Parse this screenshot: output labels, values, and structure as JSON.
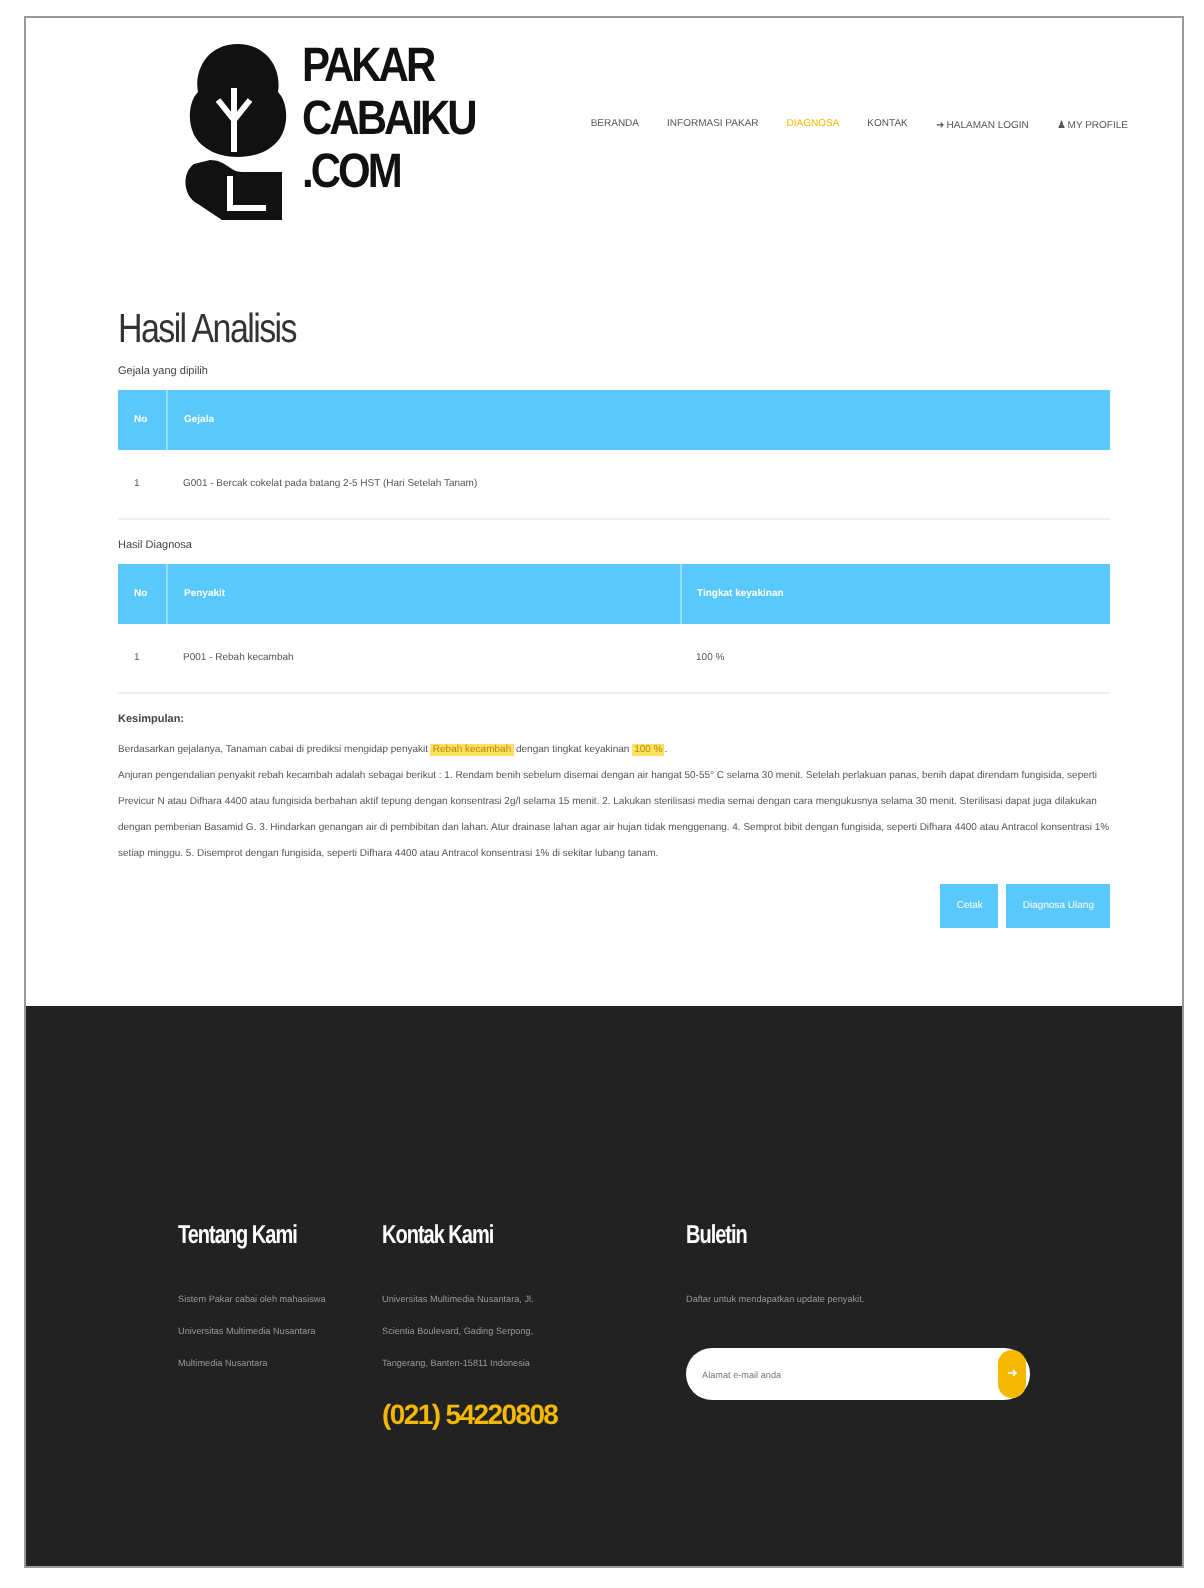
{
  "header": {
    "logo_text": [
      "PAKAR",
      "CABAIKU",
      ".COM"
    ],
    "nav": [
      {
        "label": "BERANDA",
        "selected": false
      },
      {
        "label": "INFORMASI PAKAR",
        "selected": false
      },
      {
        "label": "DIAGNOSA",
        "selected": true
      },
      {
        "label": "KONTAK",
        "selected": false
      },
      {
        "label": "➜ HALAMAN LOGIN",
        "selected": false
      },
      {
        "label": "♟ MY PROFILE",
        "selected": false
      }
    ]
  },
  "title": "Hasil Analisis",
  "tables": [
    {
      "caption": "Gejala yang dipilih",
      "columns": [
        "No",
        "Gejala"
      ],
      "rows": [
        [
          "1",
          "G001 - Bercak cokelat pada batang 2-5 HST (Hari Setelah Tanam)"
        ]
      ]
    },
    {
      "caption": "Hasil Diagnosa",
      "columns": [
        "No",
        "Penyakit",
        "Tingkat keyakinan"
      ],
      "rows": [
        [
          "1",
          "P001 - Rebah kecambah",
          "100 %"
        ]
      ]
    }
  ],
  "conclusion": {
    "heading": "Kesimpulan:",
    "paragraphs": [
      "Berdasarkan gejalanya, Tanaman cabai di prediksi mengidap penyakit **Rebah kecambah** dengan tingkat keyakinan **100 %**.",
      "Anjuran pengendalian penyakit rebah kecambah adalah sebagai berikut : 1. Rendam benih sebelum disemai dengan air hangat 50-55° C selama 30 menit. Setelah perlakuan panas, benih dapat direndam fungisida, seperti Previcur N atau Difhara 4400 atau fungisida berbahan aktif tepung dengan konsentrasi 2g/l selama 15 menit. 2. Lakukan sterilisasi media semai dengan cara mengukusnya selama 30 menit. Sterilisasi dapat juga dilakukan dengan pemberian Basamid G. 3. Hindarkan genangan air di pembibitan dan lahan. Atur drainase lahan agar air hujan tidak menggenang. 4. Semprot bibit dengan fungisida, seperti Difhara 4400 atau Antracol konsentrasi 1% setiap minggu. 5. Disemprot dengan fungisida, seperti Difhara 4400 atau Antracol konsentrasi 1% di sekitar lubang tanam."
    ]
  },
  "buttons": [
    "Cetak",
    "Diagnosa Ulang"
  ],
  "footer": {
    "columns": [
      {
        "heading": "Tentang Kami",
        "lines": [
          "Sistem Pakar cabai oleh mahasiswa",
          "Universitas Multimedia Nusantara",
          "Multimedia Nusantara"
        ]
      },
      {
        "heading": "Kontak Kami",
        "lines": [
          "Universitas Multimedia Nusantara, Jl.",
          "Scientia Boulevard, Gading Serpong,",
          "Tangerang, Banten-15811 Indonesia"
        ],
        "phone": "(021) 54220808"
      },
      {
        "heading": "Buletin",
        "lines": [
          "Daftar untuk mendapatkan update penyakit."
        ],
        "placeholder": "Alamat e-mail anda"
      }
    ]
  }
}
